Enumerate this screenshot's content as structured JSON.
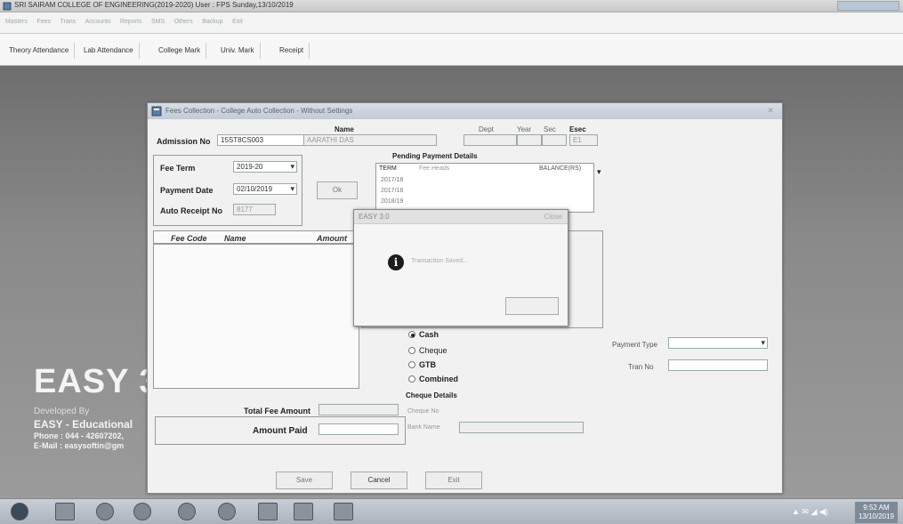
{
  "window": {
    "title": "SRI SAIRAM COLLEGE OF ENGINEERING(2019-2020)    User : FPS   Sunday,13/10/2019"
  },
  "menu": {
    "items": [
      "Masters",
      "Fees",
      "Trans",
      "Accounts",
      "Reports",
      "SMS",
      "Others",
      "Backup",
      "Exit"
    ]
  },
  "toolbar": {
    "buttons": [
      "Theory Attendance",
      "Lab Attendance",
      "College Mark",
      "Univ. Mark",
      "Receipt"
    ]
  },
  "brand": {
    "name": "EASY 3",
    "developed_by": "Developed By",
    "company": "EASY - Educational",
    "phone": "Phone : 044 - 42607202,",
    "email": "E-Mail : easysoftin@gm"
  },
  "dialog": {
    "title": "Fees Collection - College Auto Collection - Without Settings",
    "admission_label": "Admission No",
    "admission_value": "15ST8CS003",
    "name_label": "Name",
    "name_value": "AARATHI DAS",
    "dept_label": "Dept",
    "year_label": "Year",
    "sec_label": "Sec",
    "esec_label": "Esec",
    "esec_value": "E1",
    "fee_term_label": "Fee Term",
    "fee_term_value": "2019-20",
    "payment_date_label": "Payment Date",
    "payment_date_value": "02/10/2019",
    "ok_label": "Ok",
    "auto_receipt_label": "Auto Receipt No",
    "auto_receipt_value": "8177",
    "pending_title": "Pending Payment Details",
    "pending_header": "TERM",
    "pending_header2": "Fee Heads",
    "pending_header3": "BALANCE(RS)",
    "pending_rows": [
      "2017/18",
      "2017/18",
      "2018/19"
    ],
    "grid_headers": {
      "fee_code": "Fee Code",
      "name": "Name",
      "amount": "Amount"
    },
    "payment_modes": [
      "Cash",
      "Cheque",
      "GTB",
      "Combined"
    ],
    "cheque_details_label": "Cheque Details",
    "cheque_no_label": "Cheque No",
    "bank_name_label": "Bank Name",
    "payment_type_label": "Payment Type",
    "tran_no_label": "Tran No",
    "total_fee_label": "Total Fee Amount",
    "amount_paid_label": "Amount Paid",
    "save_label": "Save",
    "cancel_label": "Cancel",
    "exit_label": "Exit"
  },
  "msgbox": {
    "title": "EASY 3.0",
    "close_label": "Close",
    "info_glyph": "i",
    "message": "Transaction Saved..."
  },
  "taskbar": {
    "time": "9:52 AM",
    "date": "13/10/2019",
    "tray": "▲ ✉ ◢ ◀)"
  }
}
